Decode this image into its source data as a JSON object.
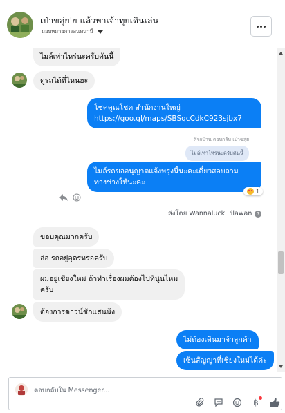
{
  "header": {
    "title": "เป่าขลุ่ย'ย แล้วพาเจ้าทุยเดินเล่น",
    "subtitle": "มอบหมายการสนทนานี้"
  },
  "messages": {
    "m1": "ไมล์เท่าไหร่นะครับคันนี้",
    "m2": "ดูรถได้ที่ไหนฮะ",
    "m3_line1": "โชคคูณโชค สำนักงานใหญ่",
    "m3_link": "https://goo.gl/maps/SBSqcCdkC923sjbx7",
    "reply_meta": "ศิรกบ้าน ตอบกลับ เป่าขลุ่ย",
    "quote": "ไมล์เท่าไหร่นะครับคันนี้",
    "m4_line1": "ไมล์รถขออนุญาตแจ้งพรุ่งนี้นะคะเดี๋ยวสอบถาม",
    "m4_line2": "ทางช่างให้นะคะ",
    "reaction_count": "1",
    "sent_by": "ส่งโดย Wannaluck Pilawan",
    "m5": "ขอบคุณมากครับ",
    "m6": "อ่อ รถอยู่อุดรหรอครับ",
    "m7_line1": "ผมอยู่เชียงใหม่ ถ้าทำเรื่องผมต้องไปที่นู่นไหม",
    "m7_line2": "ครับ",
    "m8": "ต้องการดาวน์ชักแสนนึง",
    "m9": "ไม่ต้องเดินมาจ้าลูกค้า",
    "m10": "เซ็นสัญญาที่เชียงใหม่ได้ค่ะ"
  },
  "composer": {
    "placeholder": "ตอบกลับใน Messenger..."
  },
  "icons": [
    "avatar",
    "menu-dots-icon",
    "reply-arrow-icon",
    "smiley-icon",
    "help-icon",
    "paperclip-icon",
    "gif-icon",
    "emoji-icon",
    "baht-icon",
    "thumbs-up-icon",
    "heart-eyes-reaction-icon"
  ],
  "colors": {
    "accent": "#0b7ff5",
    "incoming": "#f0f0f0",
    "quote": "#dfe8f7"
  }
}
